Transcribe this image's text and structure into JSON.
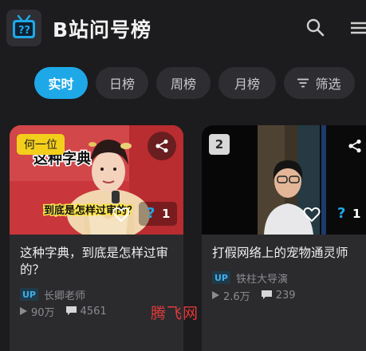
{
  "header": {
    "title": "B站问号榜",
    "logo_icon": "bilibili-tv-question-logo",
    "search_icon": "search-icon",
    "menu_icon": "menu-icon"
  },
  "tabs": [
    {
      "label": "实时",
      "active": true
    },
    {
      "label": "日榜",
      "active": false
    },
    {
      "label": "周榜",
      "active": false
    },
    {
      "label": "月榜",
      "active": false
    },
    {
      "label": "筛选",
      "active": false,
      "icon": "filter-icon"
    }
  ],
  "cards": [
    {
      "rank_label": "何一位",
      "title": "这种字典，到底是怎样过审的？",
      "up_tag": "UP",
      "uploader": "长卿老师",
      "views": "90万",
      "danmaku": "4561",
      "question_count": "1",
      "thumb_caption_top": "这种字典",
      "thumb_caption_bottom": "到底是怎样过审的？"
    },
    {
      "rank_label": "2",
      "title": "打假网络上的宠物通灵师",
      "up_tag": "UP",
      "uploader": "铁柱大导演",
      "views": "2.6万",
      "danmaku": "239",
      "question_count": "1"
    }
  ],
  "watermark": "腾飞网",
  "colors": {
    "accent": "#1ea8e8",
    "rank_gold": "#f3cf1c",
    "background": "#1c1c1e",
    "card": "#2b2b2e"
  }
}
